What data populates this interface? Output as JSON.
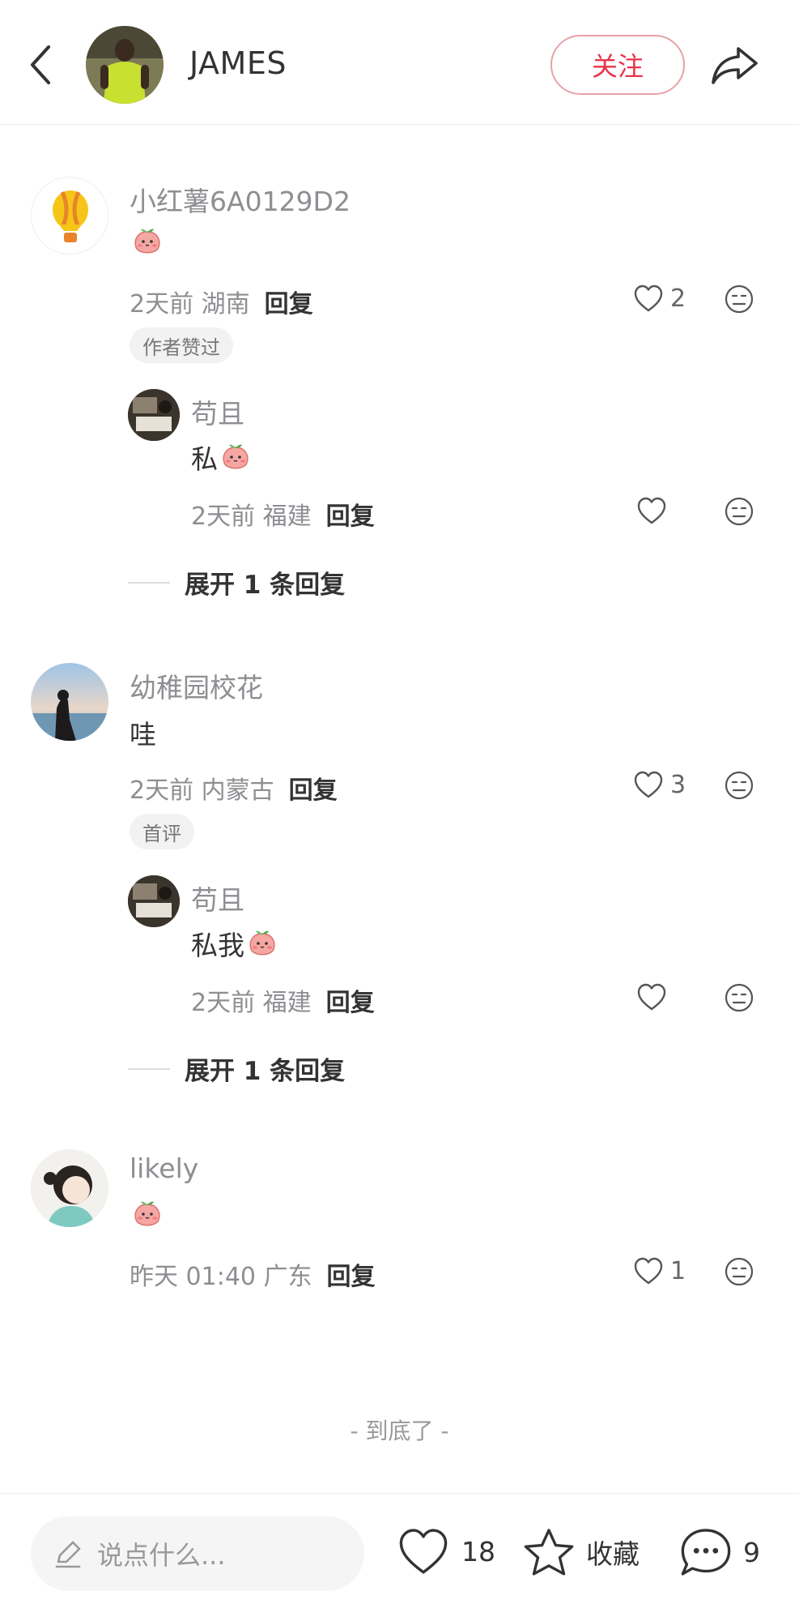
{
  "header": {
    "author_name": "JAMES",
    "follow_label": "关注"
  },
  "comments": [
    {
      "username": "小红薯6A0129D2",
      "text": "",
      "emoji": "peach-emoji",
      "time_location": "2天前 湖南",
      "reply_label": "回复",
      "likes": "2",
      "badge": "作者赞过",
      "reply": {
        "username": "苟且",
        "text": "私",
        "emoji": "peach-emoji",
        "time_location": "2天前 福建",
        "reply_label": "回复"
      },
      "expand_label": "展开 1 条回复"
    },
    {
      "username": "幼稚园校花",
      "text": "哇",
      "time_location": "2天前 内蒙古",
      "reply_label": "回复",
      "likes": "3",
      "badge": "首评",
      "reply": {
        "username": "苟且",
        "text": "私我",
        "emoji": "peach-emoji",
        "time_location": "2天前 福建",
        "reply_label": "回复"
      },
      "expand_label": "展开 1 条回复"
    },
    {
      "username": "likely",
      "text": "",
      "emoji": "peach-emoji",
      "time_location": "昨天 01:40 广东",
      "reply_label": "回复",
      "likes": "1"
    }
  ],
  "end_text": "- 到底了 -",
  "bottom_bar": {
    "input_placeholder": "说点什么...",
    "like_count": "18",
    "collect_label": "收藏",
    "comment_count": "9"
  },
  "colors": {
    "accent": "#e8344b",
    "muted_text": "#8e8e93",
    "badge_bg": "#f2f2f2"
  }
}
